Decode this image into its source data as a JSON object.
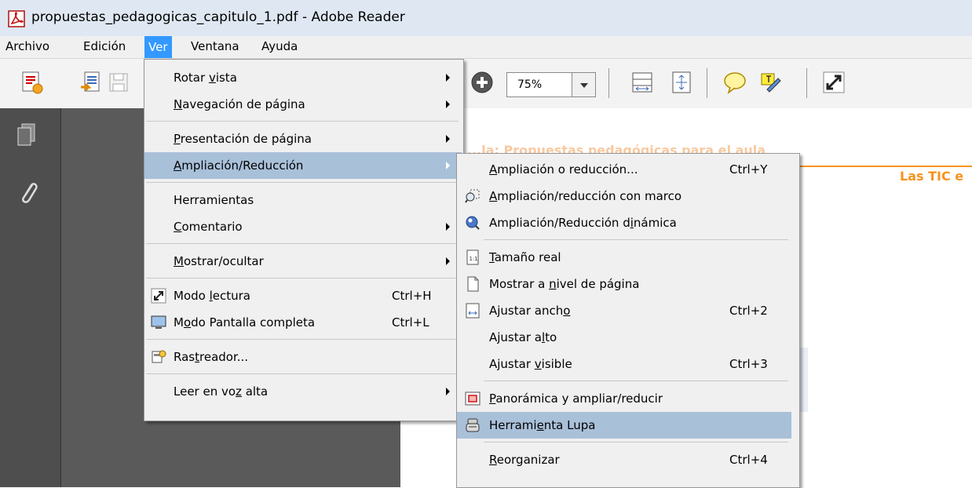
{
  "window": {
    "title": "propuestas_pedagogicas_capitulo_1.pdf - Adobe Reader"
  },
  "menubar": [
    "Archivo",
    "Edición",
    "Ver",
    "Ventana",
    "Ayuda"
  ],
  "toolbar": {
    "zoom_value": "75%"
  },
  "document": {
    "header_right": "Las TIC e",
    "faint_title": "...la: Propuestas pedagógicas para el aula"
  },
  "ver_menu": [
    {
      "label": "Rotar vista",
      "u": 6,
      "submenu": true
    },
    {
      "label": "Navegación de página",
      "u": 0,
      "submenu": true
    },
    {
      "label": "Presentación de página",
      "u": 0,
      "submenu": true
    },
    {
      "label": "Ampliación/Reducción",
      "u": 0,
      "submenu": true
    },
    {
      "label": "Herramientas",
      "u": -1,
      "submenu": false
    },
    {
      "label": "Comentario",
      "u": 0,
      "submenu": true
    },
    {
      "label": "Mostrar/ocultar",
      "u": 0,
      "submenu": true
    },
    {
      "label": "Modo lectura",
      "u": 5,
      "shortcut": "Ctrl+H",
      "icon": "reading-mode-icon"
    },
    {
      "label": "Modo Pantalla completa",
      "u": 1,
      "shortcut": "Ctrl+L",
      "icon": "fullscreen-icon"
    },
    {
      "label": "Rastreador...",
      "u": 3,
      "icon": "tracker-icon"
    },
    {
      "label": "Leer en voz alta",
      "u": 10,
      "submenu": true
    }
  ],
  "zoom_menu": [
    {
      "label": "Ampliación o reducción...",
      "u": 0,
      "shortcut": "Ctrl+Y"
    },
    {
      "label": "Ampliación/reducción con marco",
      "u": 0,
      "icon": "marquee-zoom-icon"
    },
    {
      "label": "Ampliación/Reducción dinámica",
      "u": 22,
      "icon": "dynamic-zoom-icon"
    },
    {
      "label": "Tamaño real",
      "u": 0,
      "icon": "actual-size-icon"
    },
    {
      "label": "Mostrar a nivel de página",
      "u": 10,
      "icon": "fit-page-icon"
    },
    {
      "label": "Ajustar ancho",
      "u": 12,
      "shortcut": "Ctrl+2",
      "icon": "fit-width-icon"
    },
    {
      "label": "Ajustar alto",
      "u": 9
    },
    {
      "label": "Ajustar visible",
      "u": 8,
      "shortcut": "Ctrl+3"
    },
    {
      "label": "Panorámica y ampliar/reducir",
      "u": 0,
      "icon": "pan-zoom-icon"
    },
    {
      "label": "Herramienta Lupa",
      "u": 7,
      "icon": "loupe-icon"
    },
    {
      "label": "Reorganizar",
      "u": 0,
      "shortcut": "Ctrl+4"
    }
  ],
  "colors": {
    "accent": "#3399ff",
    "highlight": "#a9c0d9",
    "doc_orange": "#f7931e"
  }
}
